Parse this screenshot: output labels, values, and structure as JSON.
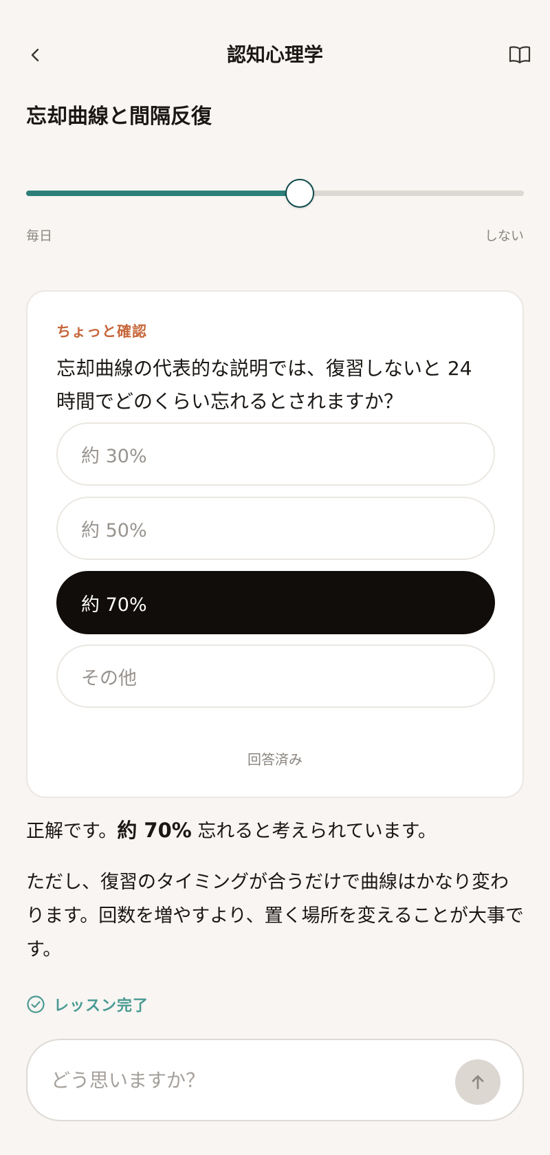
{
  "header": {
    "title": "認知心理学",
    "back_icon": "chevron-left-icon",
    "book_icon": "book-open-icon"
  },
  "lesson": {
    "title": "忘却曲線と間隔反復"
  },
  "slider": {
    "value_fraction": 0.55,
    "label_left": "毎日",
    "label_right": "しない",
    "accent_color": "#2e7f7a"
  },
  "quiz": {
    "kicker": "ちょっと確認",
    "question": "忘却曲線の代表的な説明では、復習しないと 24 時間でどのくらい忘れるとされますか？",
    "options": [
      {
        "label": "約 30%",
        "selected": false
      },
      {
        "label": "約 50%",
        "selected": false
      },
      {
        "label": "約 70%",
        "selected": true
      },
      {
        "label": "その他",
        "selected": false
      }
    ],
    "status": "回答済み",
    "kicker_color": "#c7663a"
  },
  "feedback": {
    "prefix": "正解です。",
    "answer": "約 70%",
    "suffix": " 忘れると考えられています。"
  },
  "explanation": {
    "text": "ただし、復習のタイミングが合うだけで曲線はかなり変わります。回数を増やすより、置く場所を変えることが大事です。"
  },
  "completion": {
    "label": "レッスン完了",
    "icon": "check-circle-icon"
  },
  "chat": {
    "placeholder": "どう思いますか？",
    "send_icon": "arrow-up-icon"
  }
}
